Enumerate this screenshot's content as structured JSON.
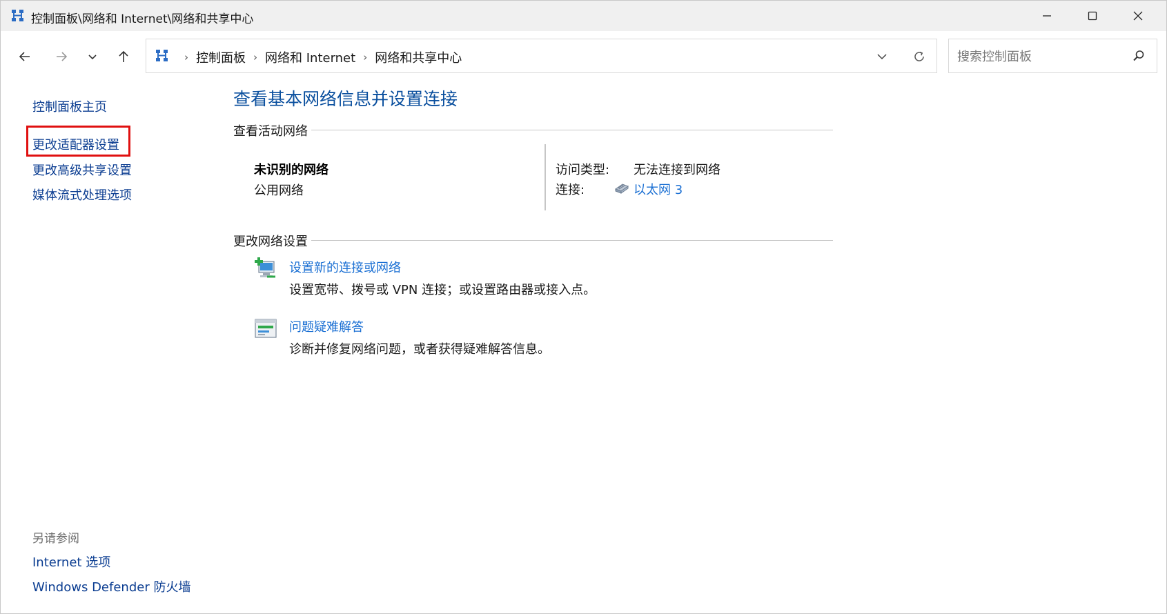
{
  "window": {
    "title": "控制面板\\网络和 Internet\\网络和共享中心"
  },
  "address_bar": {
    "crumbs": [
      "控制面板",
      "网络和 Internet",
      "网络和共享中心"
    ],
    "separator": "›"
  },
  "search": {
    "placeholder": "搜索控制面板",
    "value": ""
  },
  "sidebar": {
    "home": "控制面板主页",
    "items": [
      "更改适配器设置",
      "更改高级共享设置",
      "媒体流式处理选项"
    ],
    "see_also_heading": "另请参阅",
    "see_also": [
      "Internet 选项",
      "Windows Defender 防火墙"
    ]
  },
  "main": {
    "title": "查看基本网络信息并设置连接",
    "active_heading": "查看活动网络",
    "network": {
      "name": "未识别的网络",
      "type": "公用网络",
      "access_label": "访问类型:",
      "access_value": "无法连接到网络",
      "connection_label": "连接:",
      "connection_value": "以太网 3"
    },
    "settings_heading": "更改网络设置",
    "tasks": [
      {
        "link": "设置新的连接或网络",
        "desc": "设置宽带、拨号或 VPN 连接；或设置路由器或接入点。",
        "icon": "new-connection-icon"
      },
      {
        "link": "问题疑难解答",
        "desc": "诊断并修复网络问题，或者获得疑难解答信息。",
        "icon": "troubleshoot-icon"
      }
    ]
  },
  "colors": {
    "link": "#1a6fd3",
    "sidebar_link": "#0b3d91",
    "title": "#0a4f9e",
    "highlight": "#e01010",
    "titlebar_bg": "#f0f0f0"
  }
}
